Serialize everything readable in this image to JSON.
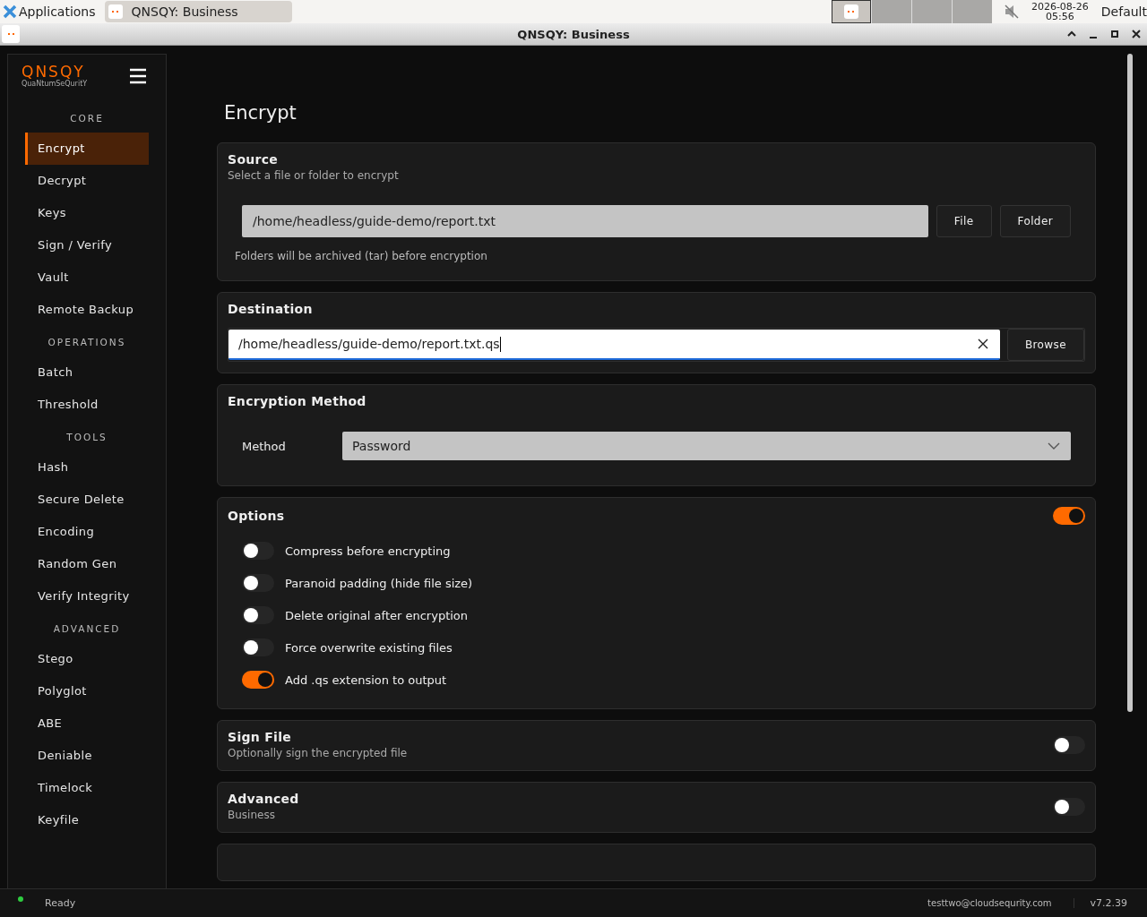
{
  "taskbar": {
    "apps_label": "Applications",
    "task": "QNSQY: Business",
    "date": "2026-08-26",
    "time": "05:56",
    "layout": "Default"
  },
  "window": {
    "title": "QNSQY: Business"
  },
  "sidebar": {
    "logo": "QNSQY",
    "tagline": "QuaNtumSeQuritY",
    "sections": [
      {
        "heading": "CORE",
        "items": [
          {
            "label": "Encrypt",
            "selected": true
          },
          {
            "label": "Decrypt",
            "selected": false
          },
          {
            "label": "Keys",
            "selected": false
          },
          {
            "label": "Sign / Verify",
            "selected": false
          },
          {
            "label": "Vault",
            "selected": false
          },
          {
            "label": "Remote Backup",
            "selected": false
          }
        ]
      },
      {
        "heading": "OPERATIONS",
        "items": [
          {
            "label": "Batch",
            "selected": false
          },
          {
            "label": "Threshold",
            "selected": false
          }
        ]
      },
      {
        "heading": "TOOLS",
        "items": [
          {
            "label": "Hash",
            "selected": false
          },
          {
            "label": "Secure Delete",
            "selected": false
          },
          {
            "label": "Encoding",
            "selected": false
          },
          {
            "label": "Random Gen",
            "selected": false
          },
          {
            "label": "Verify Integrity",
            "selected": false
          }
        ]
      },
      {
        "heading": "ADVANCED",
        "items": [
          {
            "label": "Stego",
            "selected": false
          },
          {
            "label": "Polyglot",
            "selected": false
          },
          {
            "label": "ABE",
            "selected": false
          },
          {
            "label": "Deniable",
            "selected": false
          },
          {
            "label": "Timelock",
            "selected": false
          },
          {
            "label": "Keyfile",
            "selected": false
          }
        ]
      }
    ]
  },
  "page": {
    "title": "Encrypt"
  },
  "source": {
    "title": "Source",
    "subtitle": "Select a file or folder to encrypt",
    "value": "/home/headless/guide-demo/report.txt",
    "buttons": [
      "File",
      "Folder"
    ],
    "note": "Folders will be archived (tar) before encryption"
  },
  "destination": {
    "title": "Destination",
    "value": "/home/headless/guide-demo/report.txt.qs",
    "button": "Browse"
  },
  "method": {
    "title": "Encryption Method",
    "label": "Method",
    "value": "Password"
  },
  "options": {
    "title": "Options",
    "on": true,
    "items": [
      {
        "label": "Compress before encrypting",
        "on": false
      },
      {
        "label": "Paranoid padding (hide file size)",
        "on": false
      },
      {
        "label": "Delete original after encryption",
        "on": false
      },
      {
        "label": "Force overwrite existing files",
        "on": false
      },
      {
        "label": "Add .qs extension to output",
        "on": true
      }
    ]
  },
  "sign_file": {
    "title": "Sign File",
    "subtitle": "Optionally sign the encrypted file",
    "on": false
  },
  "advanced": {
    "title": "Advanced",
    "subtitle": "Business",
    "on": false
  },
  "status_bar": {
    "status": "Ready",
    "user": "testtwo@cloudsequrity.com",
    "version": "v7.2.39"
  }
}
